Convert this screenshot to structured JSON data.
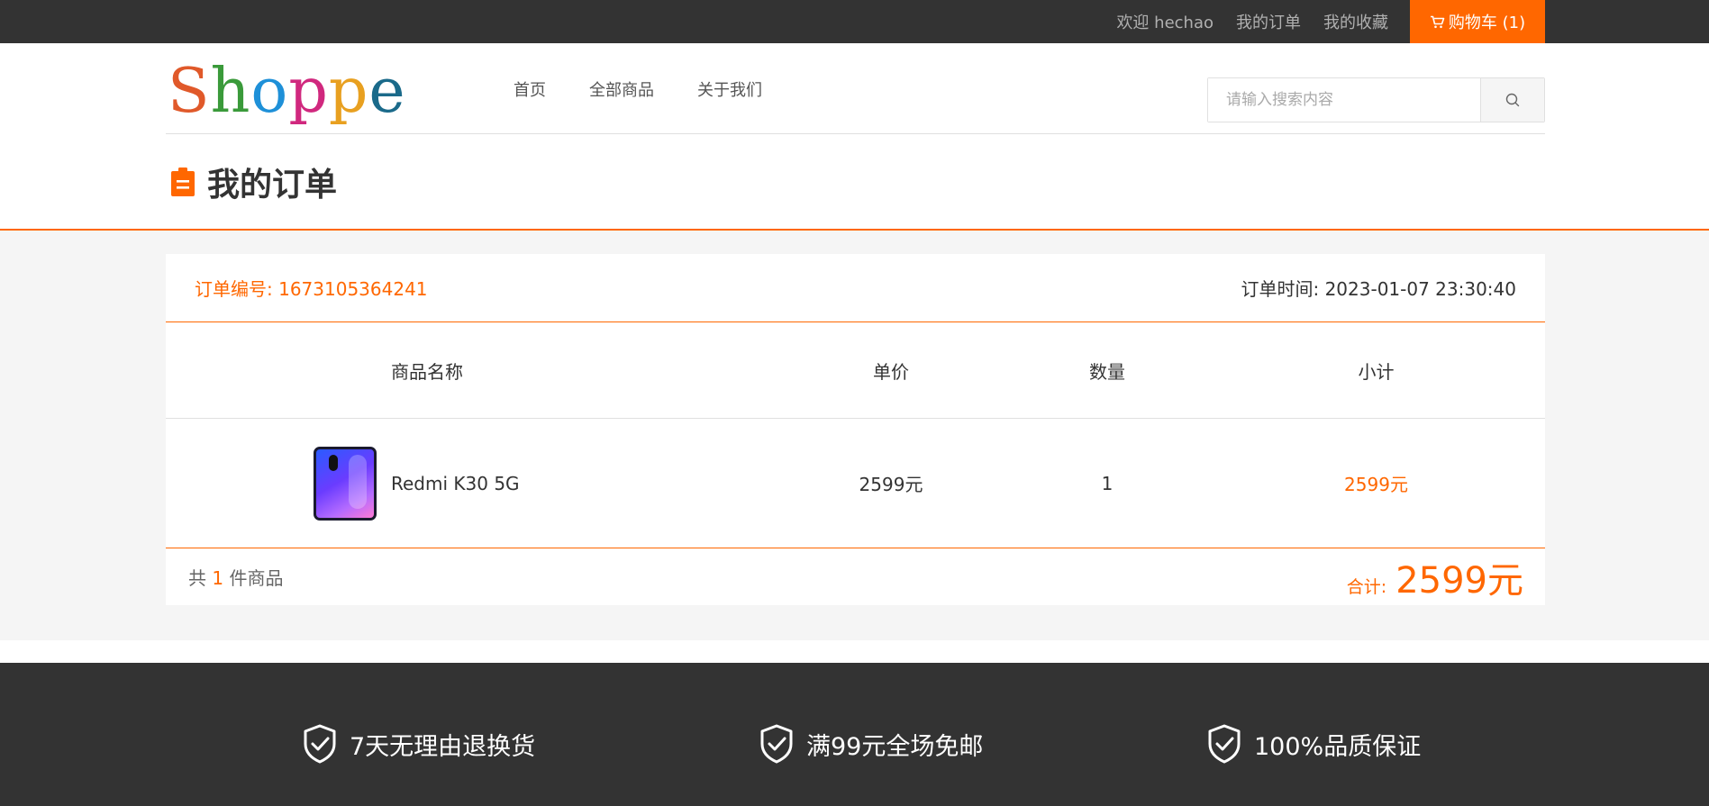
{
  "topbar": {
    "welcome": "欢迎 hechao",
    "my_orders": "我的订单",
    "my_favorites": "我的收藏",
    "cart_label": "购物车 (1)"
  },
  "header": {
    "logo_letters": [
      "S",
      "h",
      "o",
      "p",
      "p",
      "e"
    ],
    "logo_colors": [
      "#e0592a",
      "#3a9a3a",
      "#1e90d8",
      "#d0287e",
      "#e8a020",
      "#1a6a8a"
    ],
    "nav": [
      "首页",
      "全部商品",
      "关于我们"
    ],
    "search_placeholder": "请输入搜索内容"
  },
  "page": {
    "title": "我的订单"
  },
  "order": {
    "number_label": "订单编号: 1673105364241",
    "time_label": "订单时间: 2023-01-07 23:30:40",
    "columns": {
      "name": "商品名称",
      "price": "单价",
      "qty": "数量",
      "subtotal": "小计"
    },
    "items": [
      {
        "name": "Redmi K30 5G",
        "price": "2599元",
        "qty": "1",
        "subtotal": "2599元"
      }
    ],
    "count_prefix": "共",
    "count": "1",
    "count_suffix": "件商品",
    "total_label": "合计:",
    "total_value": "2599元"
  },
  "footer": {
    "features": [
      "7天无理由退换货",
      "满99元全场免邮",
      "100%品质保证"
    ]
  },
  "colors": {
    "accent": "#ff6700",
    "dark": "#333333",
    "bg": "#f5f5f5"
  }
}
